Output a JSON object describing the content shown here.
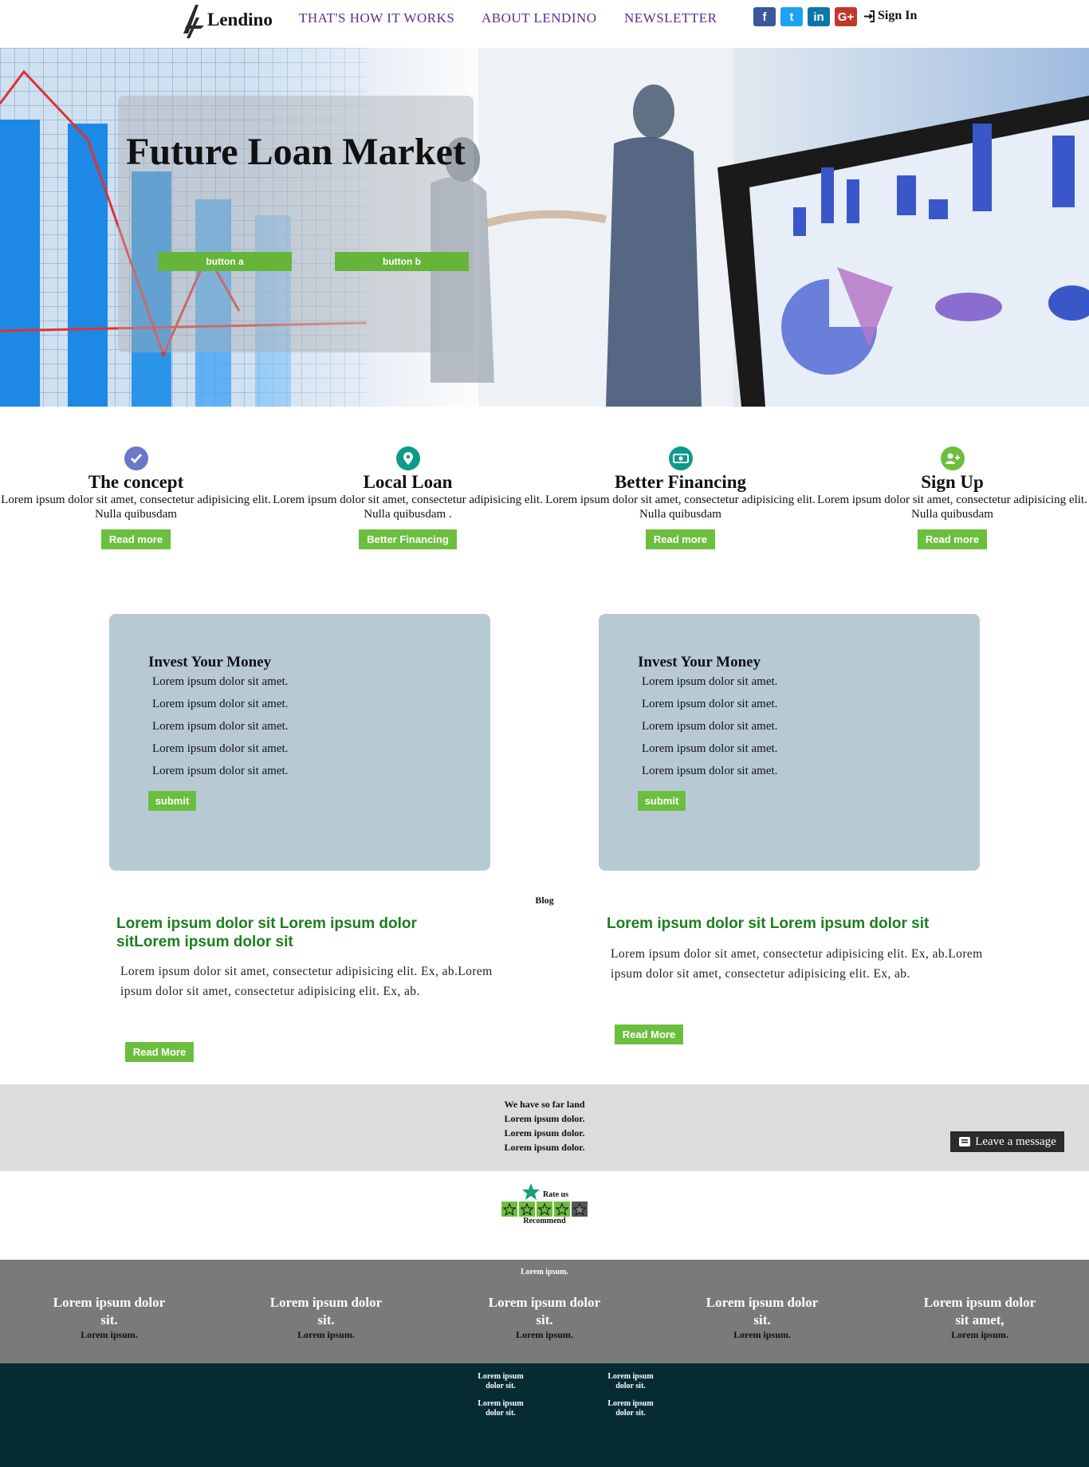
{
  "nav": {
    "brand": "Lendino",
    "links": [
      "THAT'S HOW IT WORKS",
      "ABOUT LENDINO",
      "NEWSLETTER"
    ],
    "social": [
      {
        "name": "facebook",
        "glyph": "f",
        "color": "#3b5998"
      },
      {
        "name": "twitter",
        "glyph": "t",
        "color": "#1da1f2"
      },
      {
        "name": "linkedin",
        "glyph": "in",
        "color": "#0e76a8"
      },
      {
        "name": "google-plus",
        "glyph": "G+",
        "color": "#c0392b"
      }
    ],
    "signin": "Sign In",
    "link_color": "#5a2d8c"
  },
  "hero": {
    "title": "Future Loan Market",
    "button_a": "button a",
    "button_b": "button b"
  },
  "features": [
    {
      "icon": "check-circle-icon",
      "icon_color": "#6b77c9",
      "title": "The concept",
      "text": "Lorem ipsum dolor sit amet, consectetur adipisicing elit. Nulla quibusdam",
      "button": "Read more"
    },
    {
      "icon": "map-pin-icon",
      "icon_color": "#0e9a8a",
      "title": "Local Loan",
      "text": "Lorem ipsum dolor sit amet, consectetur adipisicing elit. Nulla quibusdam .",
      "button": "Better Financing"
    },
    {
      "icon": "money-icon",
      "icon_color": "#0e9a8a",
      "title": "Better Financing",
      "text": "Lorem ipsum dolor sit amet, consectetur adipisicing elit. Nulla quibusdam",
      "button": "Read more"
    },
    {
      "icon": "user-plus-icon",
      "icon_color": "#6cbf3e",
      "title": "Sign Up",
      "text": "Lorem ipsum dolor sit amet, consectetur adipisicing elit. Nulla quibusdam",
      "button": "Read more"
    }
  ],
  "invest_cards": [
    {
      "title": "Invest Your Money",
      "items": [
        "Lorem ipsum dolor sit amet.",
        "Lorem ipsum dolor sit amet.",
        "Lorem ipsum dolor sit amet.",
        "Lorem ipsum dolor sit amet.",
        "Lorem ipsum dolor sit amet."
      ],
      "button": "submit"
    },
    {
      "title": "Invest Your Money",
      "items": [
        "Lorem ipsum dolor sit amet.",
        "Lorem ipsum dolor sit amet.",
        "Lorem ipsum dolor sit amet.",
        "Lorem ipsum dolor sit amet.",
        "Lorem ipsum dolor sit amet."
      ],
      "button": "submit"
    }
  ],
  "blog": {
    "heading": "Blog",
    "posts": [
      {
        "title": "Lorem ipsum dolor sit Lorem ipsum dolor sitLorem ipsum dolor sit",
        "text": "Lorem ipsum dolor sit amet, consectetur adipisicing elit. Ex, ab.Lorem ipsum dolor sit amet, consectetur adipisicing elit. Ex, ab.",
        "button": "Read More"
      },
      {
        "title": "Lorem ipsum dolor sit Lorem ipsum dolor sit",
        "text": "Lorem ipsum dolor sit amet, consectetur adipisicing elit. Ex, ab.Lorem ipsum dolor sit amet, consectetur adipisicing elit. Ex, ab.",
        "button": "Read More"
      }
    ]
  },
  "stats": {
    "lines": [
      "We have so far land",
      "Lorem ipsum dolor.",
      "Lorem ipsum dolor.",
      "Lorem ipsum dolor."
    ],
    "leave_message": "Leave a message"
  },
  "rating": {
    "label": "Rate us",
    "stars_filled": 4,
    "stars_total": 5,
    "recommend": "Recommend"
  },
  "footer": {
    "top": "Lorem ipsum.",
    "columns": [
      {
        "heading": "Lorem ipsum dolor sit.",
        "sub": "Lorem ipsum."
      },
      {
        "heading": "Lorem ipsum dolor sit.",
        "sub": "Lorem ipsum."
      },
      {
        "heading": "Lorem ipsum dolor sit.",
        "sub": "Lorem ipsum."
      },
      {
        "heading": "Lorem ipsum dolor sit.",
        "sub": "Lorem ipsum."
      },
      {
        "heading": "Lorem ipsum dolor sit amet,",
        "sub": "Lorem ipsum."
      }
    ],
    "links": [
      "Lorem ipsum dolor sit.",
      "Lorem ipsum dolor sit.",
      "Lorem ipsum dolor sit.",
      "Lorem ipsum dolor sit."
    ]
  },
  "colors": {
    "accent_green": "#6cbf3e",
    "card_bg": "#b7cad4",
    "blog_title": "#1c7f1c",
    "footer_grey": "#7a7a7a",
    "footer_dark": "#062b33"
  }
}
